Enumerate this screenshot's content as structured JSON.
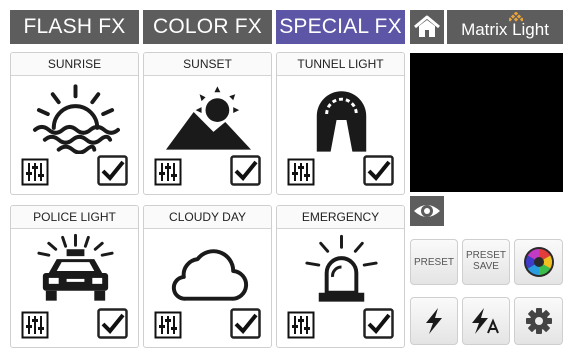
{
  "tabs": [
    {
      "label": "FLASH FX",
      "active": false
    },
    {
      "label": "COLOR FX",
      "active": false
    },
    {
      "label": "SPECIAL FX",
      "active": true
    }
  ],
  "effects": [
    {
      "title": "SUNRISE",
      "icon": "sunrise-icon",
      "checked": true
    },
    {
      "title": "SUNSET",
      "icon": "sunset-icon",
      "checked": true
    },
    {
      "title": "TUNNEL LIGHT",
      "icon": "tunnel-icon",
      "checked": true
    },
    {
      "title": "POLICE LIGHT",
      "icon": "police-car-icon",
      "checked": true
    },
    {
      "title": "CLOUDY DAY",
      "icon": "cloud-icon",
      "checked": true
    },
    {
      "title": "EMERGENCY",
      "icon": "beacon-icon",
      "checked": true
    }
  ],
  "header": {
    "logo": "Matrix Light",
    "home_icon": "home-icon"
  },
  "buttons": {
    "preset": "PRESET",
    "preset_save_line1": "PRESET",
    "preset_save_line2": "SAVE"
  },
  "colors": {
    "tab_dark": "#5d5d5d",
    "tab_active": "#5d56a6",
    "logo_accent": "#e9a43b"
  }
}
